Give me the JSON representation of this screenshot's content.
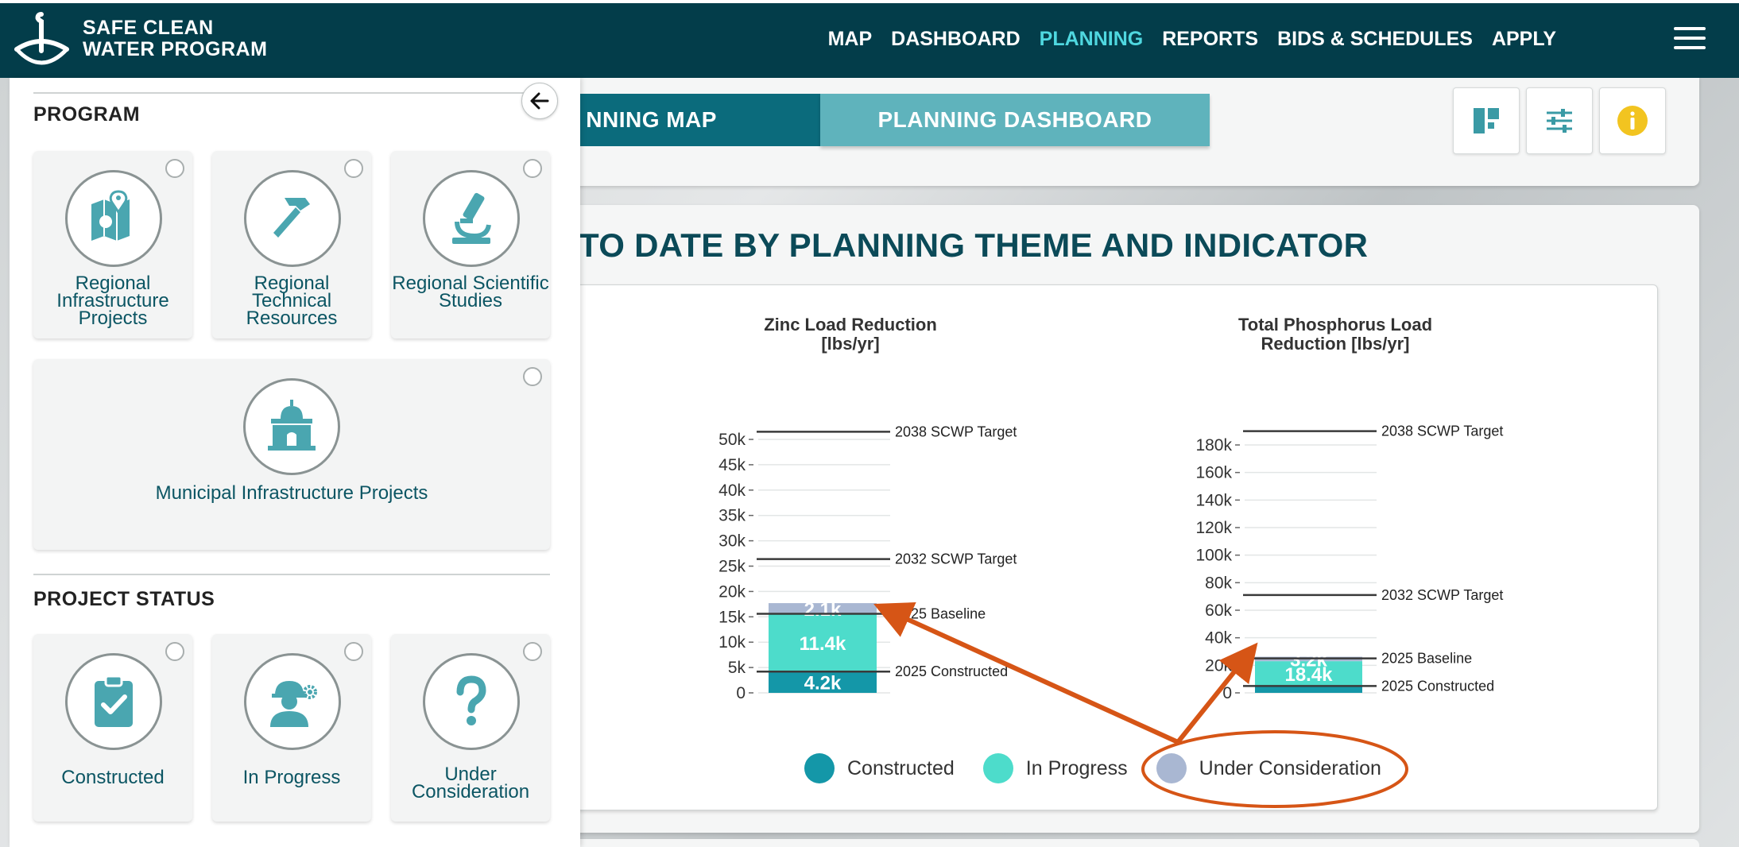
{
  "brand": {
    "line1": "SAFE CLEAN",
    "line2": "WATER PROGRAM"
  },
  "nav": [
    {
      "label": "MAP",
      "active": false
    },
    {
      "label": "DASHBOARD",
      "active": false
    },
    {
      "label": "PLANNING",
      "active": true
    },
    {
      "label": "REPORTS",
      "active": false
    },
    {
      "label": "BIDS & SCHEDULES",
      "active": false
    },
    {
      "label": "APPLY",
      "active": false
    }
  ],
  "tabs": {
    "map": "NNING MAP",
    "dashboard": "PLANNING DASHBOARD"
  },
  "main_title": "TO DATE BY PLANNING THEME AND INDICATOR",
  "panel": {
    "program_title": "PROGRAM",
    "program_tiles": [
      {
        "label": "Regional Infrastructure Projects",
        "icon": "map-pin-icon"
      },
      {
        "label": "Regional Technical Resources",
        "icon": "hammer-icon"
      },
      {
        "label": "Regional Scientific Studies",
        "icon": "microscope-icon"
      },
      {
        "label": "Municipal Infrastructure Projects",
        "icon": "city-hall-icon"
      }
    ],
    "status_title": "PROJECT STATUS",
    "status_tiles": [
      {
        "label": "Constructed",
        "icon": "clipboard-check-icon"
      },
      {
        "label": "In Progress",
        "icon": "worker-gear-icon"
      },
      {
        "label": "Under Consideration",
        "icon": "question-icon"
      }
    ]
  },
  "colors": {
    "constructed": "#1497a8",
    "in_progress": "#4ddccb",
    "under_consideration": "#a9b7d2",
    "accent": "#4fd8e0",
    "header": "#033d4a",
    "annotation": "#d65516",
    "icon": "#4aa6b0"
  },
  "chart_data": [
    {
      "type": "bar",
      "title": "Zinc Load Reduction [lbs/yr]",
      "title_line1": "Zinc Load Reduction",
      "title_line2": "[lbs/yr]",
      "ylim": [
        0,
        50000
      ],
      "yticks": [
        "0",
        "5k",
        "10k",
        "15k",
        "20k",
        "25k",
        "30k",
        "35k",
        "40k",
        "45k",
        "50k"
      ],
      "series": [
        {
          "name": "Constructed",
          "value": 4200,
          "label": "4.2k"
        },
        {
          "name": "In Progress",
          "value": 11400,
          "label": "11.4k"
        },
        {
          "name": "Under Consideration",
          "value": 2100,
          "label": "2.1k"
        }
      ],
      "reference_lines": [
        {
          "name": "2038 SCWP Target",
          "value": 51500
        },
        {
          "name": "2032 SCWP Target",
          "value": 26400
        },
        {
          "name": "2025 Baseline",
          "value": 15600
        },
        {
          "name": "2025 Constructed",
          "value": 4200
        }
      ]
    },
    {
      "type": "bar",
      "title": "Total Phosphorus Load Reduction [lbs/yr]",
      "title_line1": "Total Phosphorus Load",
      "title_line2": "Reduction [lbs/yr]",
      "ylim": [
        0,
        180000
      ],
      "yticks": [
        "0",
        "20k",
        "40k",
        "60k",
        "80k",
        "100k",
        "120k",
        "140k",
        "160k",
        "180k"
      ],
      "series": [
        {
          "name": "Constructed",
          "value": 4600,
          "label": ""
        },
        {
          "name": "In Progress",
          "value": 18400,
          "label": "18.4k"
        },
        {
          "name": "Under Consideration",
          "value": 3200,
          "label": "3.2k"
        }
      ],
      "reference_lines": [
        {
          "name": "2038 SCWP Target",
          "value": 190000
        },
        {
          "name": "2032 SCWP Target",
          "value": 71000
        },
        {
          "name": "2025 Baseline",
          "value": 25000
        },
        {
          "name": "2025 Constructed",
          "value": 5000
        }
      ]
    }
  ],
  "legend": [
    {
      "label": "Constructed",
      "color": "#1497a8"
    },
    {
      "label": "In Progress",
      "color": "#4ddccb"
    },
    {
      "label": "Under Consideration",
      "color": "#a9b7d2"
    }
  ]
}
